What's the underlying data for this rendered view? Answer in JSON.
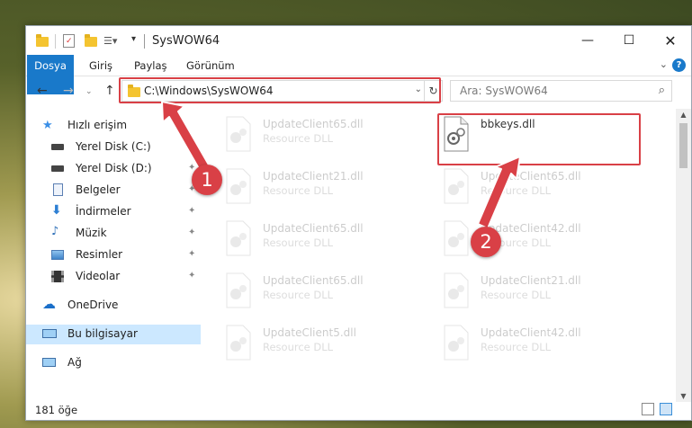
{
  "window": {
    "title": "SysWOW64"
  },
  "ribbon": {
    "tabs": [
      "Dosya",
      "Giriş",
      "Paylaş",
      "Görünüm"
    ]
  },
  "address": {
    "path": "C:\\Windows\\SysWOW64"
  },
  "search": {
    "placeholder": "Ara: SysWOW64"
  },
  "sidebar": {
    "items": [
      {
        "label": "Hızlı erişim",
        "icon": "star-icon"
      },
      {
        "label": "Yerel Disk (C:)",
        "icon": "drive-icon"
      },
      {
        "label": "Yerel Disk (D:)",
        "icon": "drive-icon"
      },
      {
        "label": "Belgeler",
        "icon": "document-icon"
      },
      {
        "label": "İndirmeler",
        "icon": "download-icon"
      },
      {
        "label": "Müzik",
        "icon": "music-icon"
      },
      {
        "label": "Resimler",
        "icon": "pictures-icon"
      },
      {
        "label": "Videolar",
        "icon": "video-icon"
      },
      {
        "label": "OneDrive",
        "icon": "cloud-icon"
      },
      {
        "label": "Bu bilgisayar",
        "icon": "computer-icon"
      },
      {
        "label": "Ağ",
        "icon": "network-icon"
      }
    ]
  },
  "files": [
    {
      "name": "UpdateClient65.dll",
      "type": "Resource DLL"
    },
    {
      "name": "bbkeys.dll",
      "type": ""
    },
    {
      "name": "UpdateClient21.dll",
      "type": "Resource DLL"
    },
    {
      "name": "UpdateClient65.dll",
      "type": "Resource DLL"
    },
    {
      "name": "UpdateClient65.dll",
      "type": "Resource DLL"
    },
    {
      "name": "UpdateClient42.dll",
      "type": "Resource DLL"
    },
    {
      "name": "UpdateClient65.dll",
      "type": "Resource DLL"
    },
    {
      "name": "UpdateClient21.dll",
      "type": "Resource DLL"
    },
    {
      "name": "UpdateClient5.dll",
      "type": "Resource DLL"
    },
    {
      "name": "UpdateClient42.dll",
      "type": "Resource DLL"
    }
  ],
  "status": {
    "count": "181 öğe"
  },
  "annotations": {
    "step1": "1",
    "step2": "2",
    "color": "#d94046"
  }
}
